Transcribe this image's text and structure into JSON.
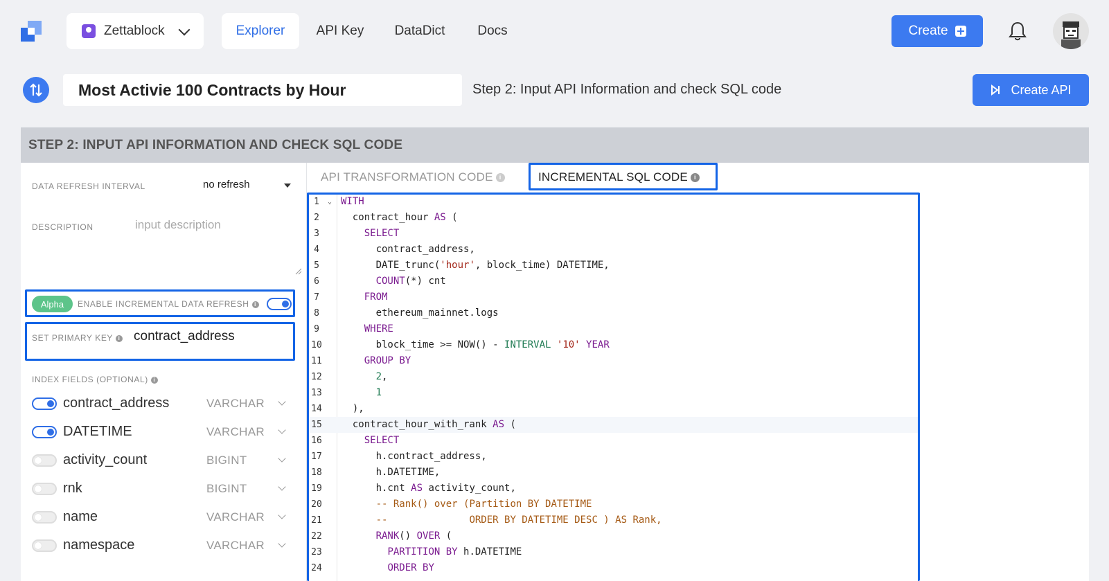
{
  "workspace": {
    "name": "Zettablock"
  },
  "nav": {
    "tabs": [
      {
        "label": "Explorer",
        "active": true
      },
      {
        "label": "API Key",
        "active": false
      },
      {
        "label": "DataDict",
        "active": false
      },
      {
        "label": "Docs",
        "active": false
      }
    ],
    "create_label": "Create"
  },
  "title_row": {
    "query_title": "Most Activie 100 Contracts by Hour",
    "step_text": "Step 2: Input API Information and check SQL code",
    "create_api_label": "Create API"
  },
  "panel": {
    "header": "STEP 2: INPUT API INFORMATION AND CHECK SQL CODE",
    "refresh": {
      "label": "DATA REFRESH INTERVAL",
      "value": "no refresh"
    },
    "description": {
      "label": "DESCRIPTION",
      "placeholder": "input description"
    },
    "incremental": {
      "badge": "Alpha",
      "label": "ENABLE INCREMENTAL DATA REFRESH",
      "enabled": true
    },
    "primary_key": {
      "label": "SET PRIMARY KEY",
      "value": "contract_address"
    },
    "index_fields": {
      "label": "INDEX FIELDS (OPTIONAL)",
      "fields": [
        {
          "name": "contract_address",
          "type": "VARCHAR",
          "enabled": true
        },
        {
          "name": "DATETIME",
          "type": "VARCHAR",
          "enabled": true
        },
        {
          "name": "activity_count",
          "type": "BIGINT",
          "enabled": false
        },
        {
          "name": "rnk",
          "type": "BIGINT",
          "enabled": false
        },
        {
          "name": "name",
          "type": "VARCHAR",
          "enabled": false
        },
        {
          "name": "namespace",
          "type": "VARCHAR",
          "enabled": false
        }
      ]
    },
    "tabs": [
      {
        "label": "API TRANSFORMATION CODE",
        "active": false
      },
      {
        "label": "INCREMENTAL SQL CODE",
        "active": true
      }
    ]
  },
  "editor": {
    "current_line": 15,
    "lines": [
      "WITH",
      "  contract_hour AS (",
      "    SELECT",
      "      contract_address,",
      "      DATE_trunc('hour', block_time) DATETIME,",
      "      COUNT(*) cnt",
      "    FROM",
      "      ethereum_mainnet.logs",
      "    WHERE",
      "      block_time >= NOW() - INTERVAL '10' YEAR",
      "    GROUP BY",
      "      2,",
      "      1",
      "  ),",
      "  contract_hour_with_rank AS (",
      "    SELECT",
      "      h.contract_address,",
      "      h.DATETIME,",
      "      h.cnt AS activity_count,",
      "      -- Rank() over (Partition BY DATETIME",
      "      --              ORDER BY DATETIME DESC ) AS Rank,",
      "      RANK() OVER (",
      "        PARTITION BY h.DATETIME",
      "        ORDER BY"
    ]
  },
  "colors": {
    "accent": "#3c7af0",
    "highlight_box": "#1464e6",
    "alpha_badge": "#5dc48a"
  }
}
